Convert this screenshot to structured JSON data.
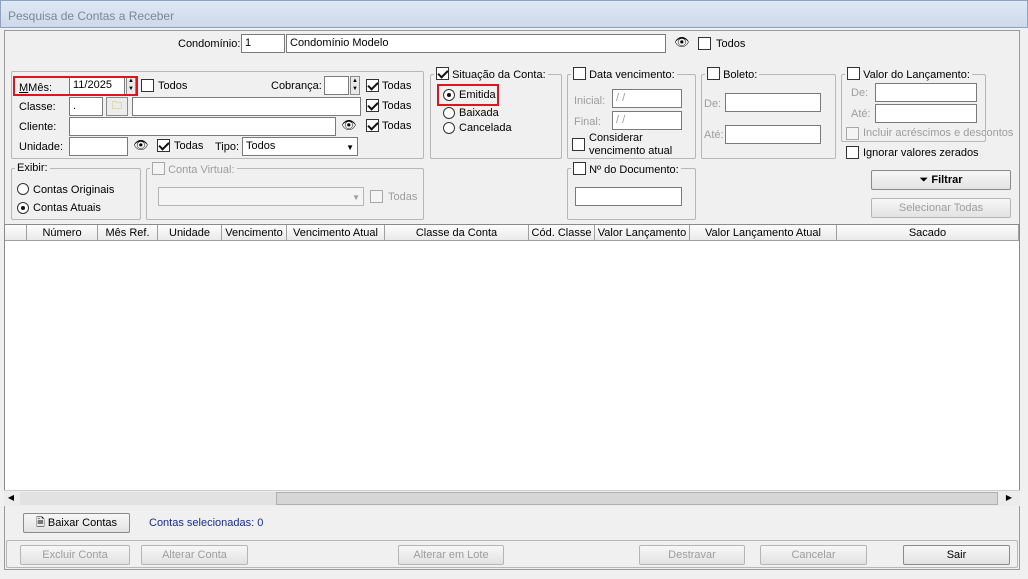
{
  "window": {
    "title": "Pesquisa de Contas a Receber"
  },
  "condominio": {
    "label": "Condomínio:",
    "code": "1",
    "name": "Condomínio Modelo",
    "todos_label": "Todos"
  },
  "mes": {
    "label": "Mês:",
    "value": "11/2025",
    "todos_label": "Todos"
  },
  "cobranca": {
    "label": "Cobrança:",
    "value": "",
    "todas_label": "Todas"
  },
  "classe": {
    "label": "Classe:",
    "code": ".",
    "name": "",
    "todas_label": "Todas"
  },
  "cliente": {
    "label": "Cliente:",
    "value": "",
    "todas_label": "Todas"
  },
  "unidade": {
    "label": "Unidade:",
    "value": "",
    "todas_label": "Todas"
  },
  "tipo": {
    "label": "Tipo:",
    "selected": "Todos"
  },
  "situacao": {
    "title": "Situação da Conta:",
    "options": [
      "Emitida",
      "Baixada",
      "Cancelada"
    ],
    "selected": "Emitida"
  },
  "data_vencimento": {
    "title": "Data vencimento:",
    "inicial_label": "Inicial:",
    "inicial_value": " / /",
    "final_label": "Final:",
    "final_value": " / /",
    "considerar_label_1": "Considerar",
    "considerar_label_2": "vencimento atual"
  },
  "boleto": {
    "title": "Boleto:",
    "de_label": "De:",
    "ate_label": "Até:"
  },
  "valor_lancamento": {
    "title": "Valor do Lançamento:",
    "de_label": "De:",
    "ate_label": "Até:",
    "incluir_label": "Incluir acréscimos e descontos"
  },
  "ignorar_label": "Ignorar valores zerados",
  "exibir": {
    "title": "Exibir:",
    "options": [
      "Contas Originais",
      "Contas Atuais"
    ],
    "selected": "Contas Atuais"
  },
  "conta_virtual": {
    "title": "Conta Virtual:",
    "todas_label": "Todas"
  },
  "documento": {
    "title": "Nº do Documento:"
  },
  "buttons": {
    "filtrar": "Filtrar",
    "selecionar_todas": "Selecionar Todas",
    "baixar_contas": "Baixar Contas",
    "excluir_conta": "Excluir Conta",
    "alterar_conta": "Alterar Conta",
    "alterar_lote": "Alterar em Lote",
    "destravar": "Destravar",
    "cancelar": "Cancelar",
    "sair": "Sair"
  },
  "grid": {
    "columns": [
      "Número",
      "Mês Ref.",
      "Unidade",
      "Vencimento",
      "Vencimento Atual",
      "Classe da Conta",
      "Cód. Classe",
      "Valor Lançamento",
      "Valor Lançamento Atual",
      "Sacado"
    ]
  },
  "status": {
    "contas_selecionadas": "Contas selecionadas: 0"
  },
  "colors": {
    "highlight": "#e0141a",
    "status_text": "#1a2b8c",
    "window_bg": "#f0f0f0"
  }
}
